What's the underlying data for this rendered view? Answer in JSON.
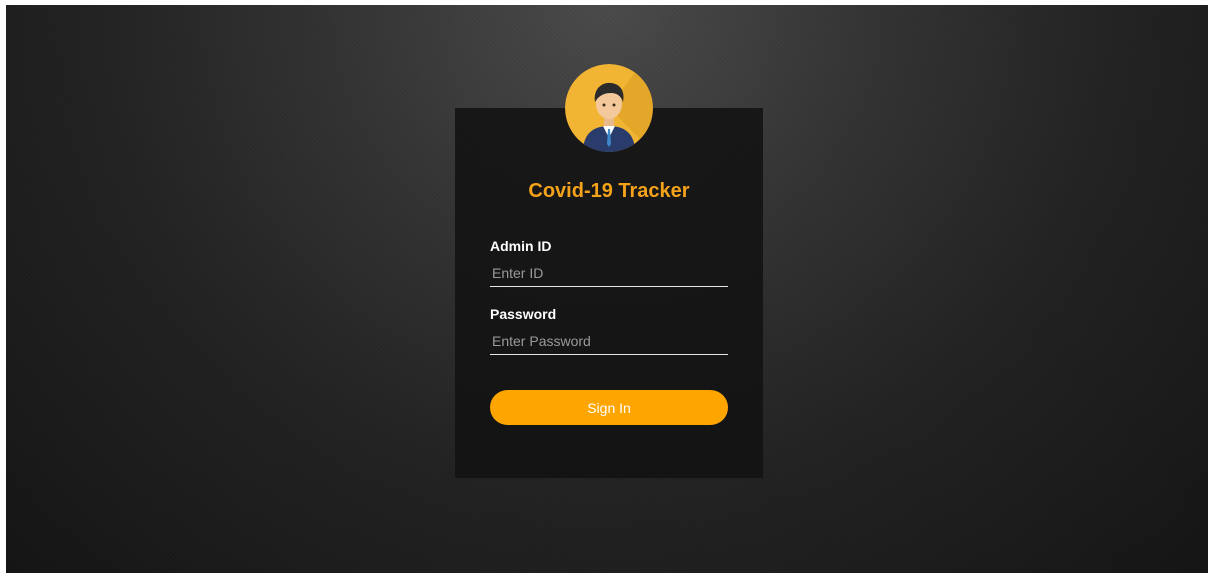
{
  "app": {
    "title": "Covid-19 Tracker"
  },
  "avatar": {
    "icon": "admin-user-icon"
  },
  "form": {
    "admin_id_label": "Admin ID",
    "admin_id_placeholder": "Enter ID",
    "admin_id_value": "",
    "password_label": "Password",
    "password_placeholder": "Enter Password",
    "password_value": "",
    "submit_label": "Sign In"
  },
  "colors": {
    "accent": "#ffa500",
    "title": "#f5a21b",
    "card_bg": "#121212",
    "avatar_bg": "#f2b533"
  }
}
